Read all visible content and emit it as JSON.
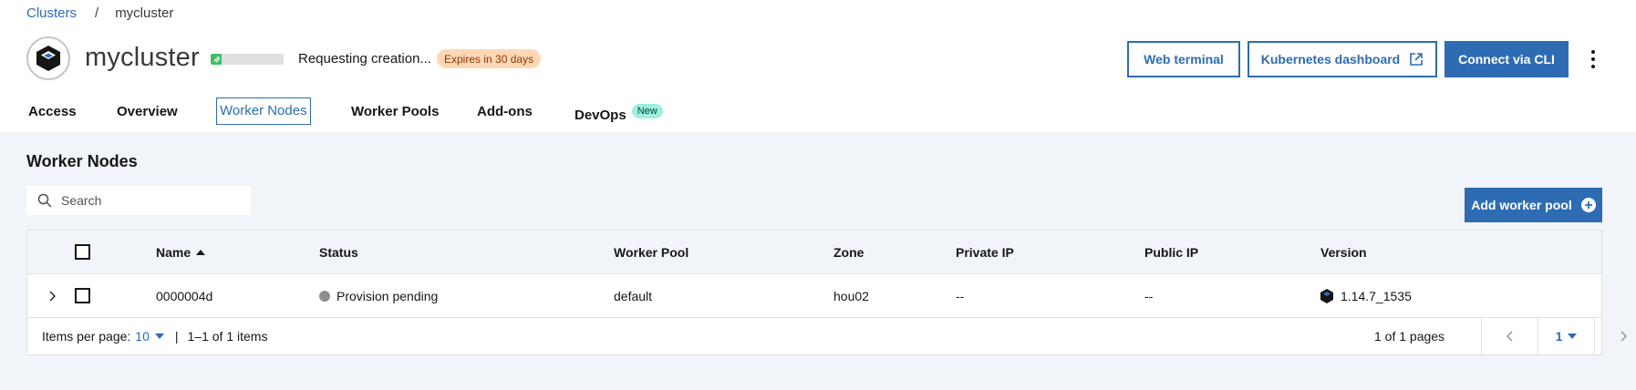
{
  "breadcrumb": {
    "root": "Clusters",
    "separator": "/",
    "current": "mycluster"
  },
  "cluster": {
    "name": "mycluster",
    "status_text": "Requesting creation...",
    "expires_badge": "Expires in 30 days",
    "progress_fraction": 0.15
  },
  "actions": {
    "web_terminal": "Web terminal",
    "kubernetes_dashboard": "Kubernetes dashboard",
    "connect_cli": "Connect via CLI"
  },
  "tabs": [
    {
      "label": "Access"
    },
    {
      "label": "Overview"
    },
    {
      "label": "Worker Nodes",
      "active": true
    },
    {
      "label": "Worker Pools"
    },
    {
      "label": "Add-ons"
    },
    {
      "label": "DevOps",
      "badge": "New"
    }
  ],
  "section": {
    "title": "Worker Nodes",
    "search_placeholder": "Search",
    "add_button": "Add worker pool"
  },
  "table": {
    "columns": [
      "Name",
      "Status",
      "Worker Pool",
      "Zone",
      "Private IP",
      "Public IP",
      "Version"
    ],
    "rows": [
      {
        "name": "0000004d",
        "status": "Provision pending",
        "worker_pool": "default",
        "zone": "hou02",
        "private_ip": "--",
        "public_ip": "--",
        "version": "1.14.7_1535"
      }
    ]
  },
  "pagination": {
    "items_per_page_label": "Items per page:",
    "items_per_page": "10",
    "separator": "|",
    "range": "1–1 of 1 items",
    "pages_text": "1 of 1 pages",
    "current_page": "1"
  },
  "colors": {
    "accent": "#2d6cb3",
    "badge_expires": "#ffd7b5",
    "badge_new": "#9ef0da",
    "status_pending": "#8d8d8d",
    "content_bg": "#f1f4f8"
  },
  "icons": {
    "cluster_logo": "kubernetes-cube-icon",
    "external_link": "launch-icon",
    "overflow": "overflow-menu-vertical-icon",
    "search": "search-icon",
    "add": "add-filled-icon",
    "expand": "chevron-right-icon",
    "version": "kubernetes-cube-icon",
    "prev": "chevron-left-icon",
    "next": "chevron-right-icon"
  }
}
